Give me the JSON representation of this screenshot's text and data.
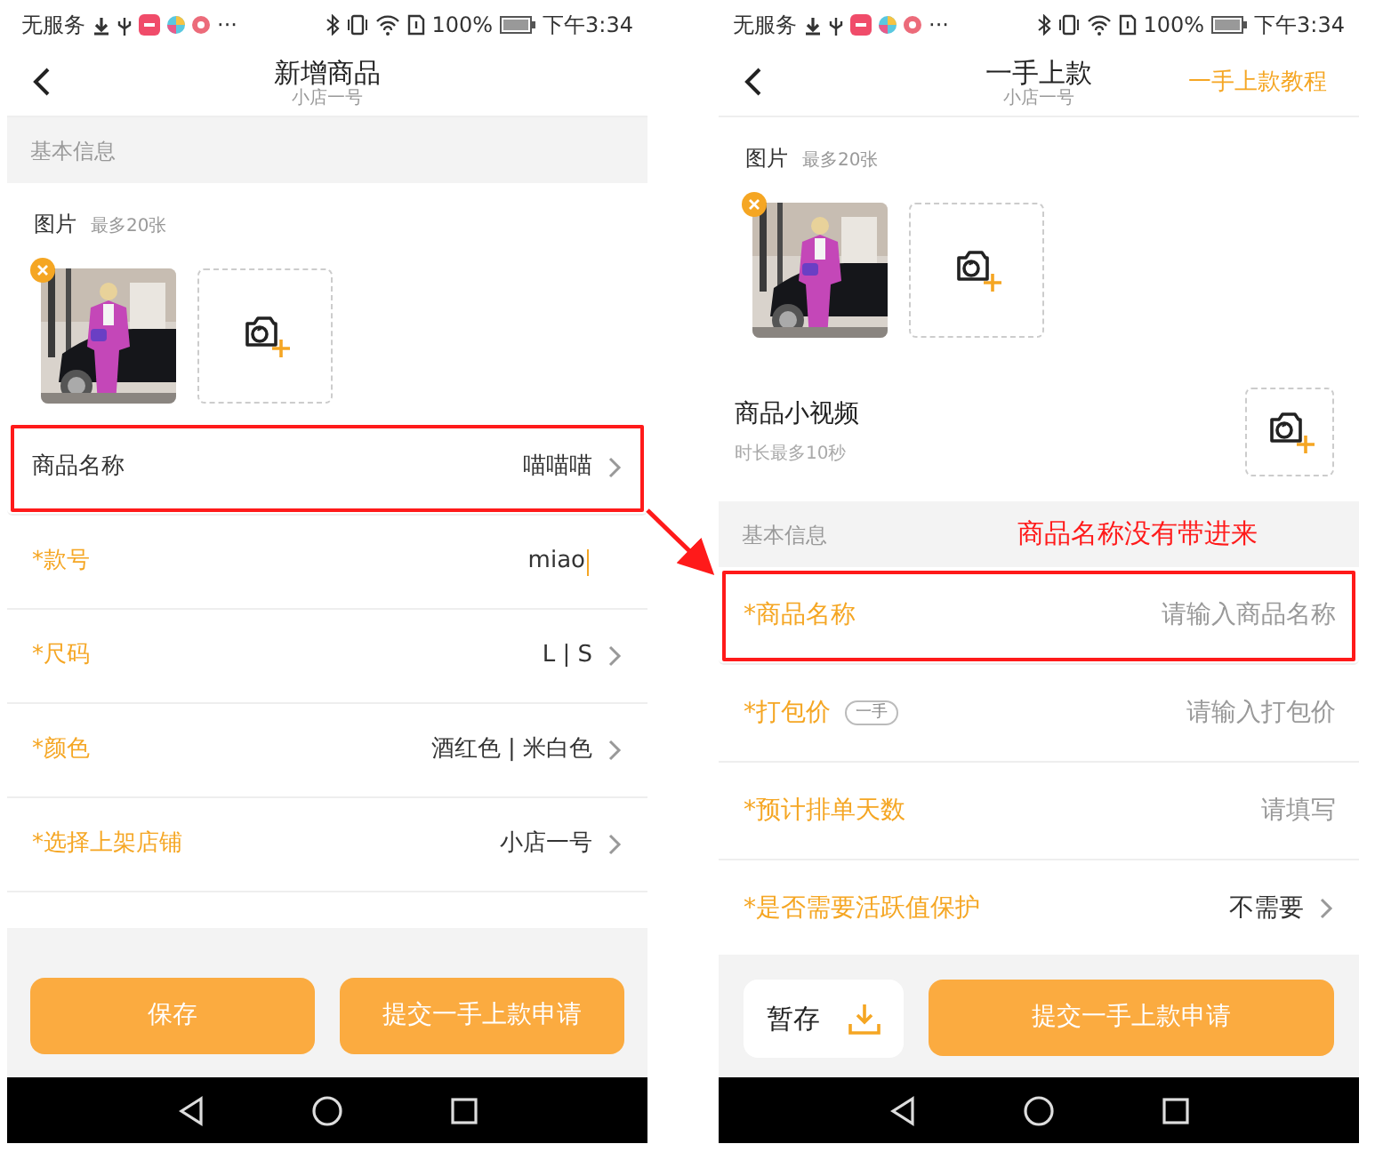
{
  "phones": [
    {
      "status_bar": {
        "carrier": "无服务",
        "more": "···",
        "battery": "100%",
        "time": "下午3:34"
      },
      "header": {
        "title": "新增商品",
        "subtitle": "小店一号"
      },
      "body": [
        {
          "kind": "section",
          "label": "基本信息"
        },
        {
          "kind": "photos",
          "label": "图片",
          "hint": "最多20张",
          "photos": [
            {
              "kind": "picture",
              "removable": true
            }
          ]
        },
        {
          "kind": "field",
          "label": "商品名称",
          "required": false,
          "value": "喵喵喵",
          "chevron": true,
          "highlighted": true
        },
        {
          "kind": "field",
          "label": "*款号",
          "required": true,
          "value": "miao",
          "cursor": true,
          "chevron": false,
          "highlighted": false
        },
        {
          "kind": "field",
          "label": "*尺码",
          "required": true,
          "value": "L | S",
          "chevron": true,
          "highlighted": false
        },
        {
          "kind": "field",
          "label": "*颜色",
          "required": true,
          "value": "酒红色 | 米白色",
          "chevron": true,
          "highlighted": false
        },
        {
          "kind": "field",
          "label": "*选择上架店铺",
          "required": true,
          "value": "小店一号",
          "chevron": true,
          "highlighted": false
        }
      ],
      "footer": [
        {
          "kind": "primary",
          "label": "保存"
        },
        {
          "kind": "primary",
          "label": "提交一手上款申请"
        }
      ]
    },
    {
      "status_bar": {
        "carrier": "无服务",
        "more": "···",
        "battery": "100%",
        "time": "下午3:34"
      },
      "header": {
        "title": "一手上款",
        "subtitle": "小店一号",
        "action": "一手上款教程"
      },
      "body": [
        {
          "kind": "photos",
          "label": "图片",
          "hint": "最多20张",
          "photos": [
            {
              "kind": "picture",
              "removable": true
            }
          ]
        },
        {
          "kind": "video",
          "label": "商品小视频",
          "hint": "时长最多10秒"
        },
        {
          "kind": "section",
          "label": "基本信息",
          "note": "商品名称没有带进来"
        },
        {
          "kind": "field",
          "label": "*商品名称",
          "required": true,
          "placeholder": "请输入商品名称",
          "chevron": false,
          "highlighted": true
        },
        {
          "kind": "field",
          "label": "*打包价",
          "badge": "一手",
          "required": true,
          "placeholder": "请输入打包价",
          "chevron": false,
          "highlighted": false
        },
        {
          "kind": "field",
          "label": "*预计排单天数",
          "required": true,
          "placeholder": "请填写",
          "chevron": false,
          "highlighted": false
        },
        {
          "kind": "field",
          "label": "*是否需要活跃值保护",
          "required": true,
          "value": "不需要",
          "chevron": true,
          "highlighted": false
        }
      ],
      "footer": [
        {
          "kind": "secondary",
          "label": "暂存"
        },
        {
          "kind": "primary",
          "label": "提交一手上款申请"
        }
      ]
    }
  ],
  "annotation": {
    "arrow": true
  }
}
